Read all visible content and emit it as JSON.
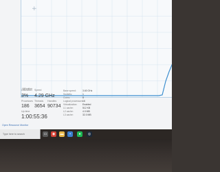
{
  "graph": {
    "title": "Utilization",
    "colors": {
      "grid": "#d4e3ef",
      "line": "#3d8fcf",
      "border": "#b9d2e6",
      "background": "#f7f9fb"
    }
  },
  "stats": {
    "utilization": {
      "label": "Utilization",
      "value": "3%"
    },
    "speed": {
      "label": "Speed",
      "value": "4.29 GHz"
    },
    "processes": {
      "label": "Processes",
      "value": "186"
    },
    "threads": {
      "label": "Threads",
      "value": "3654"
    },
    "handles": {
      "label": "Handles",
      "value": "90734"
    },
    "uptime": {
      "label": "Up time",
      "value": "1:00:55:36"
    }
  },
  "details": [
    {
      "label": "Base speed:",
      "value": "3.60 GHz"
    },
    {
      "label": "Sockets:",
      "value": "1"
    },
    {
      "label": "Cores:",
      "value": "8"
    },
    {
      "label": "Logical processors:",
      "value": "16"
    },
    {
      "label": "Virtualization:",
      "value": "Enabled"
    },
    {
      "label": "L1 cache:",
      "value": "512 KB"
    },
    {
      "label": "L2 cache:",
      "value": "4.0 MB"
    },
    {
      "label": "L3 cache:",
      "value": "32.0 MB"
    }
  ],
  "footer": {
    "resource_monitor_link": "Open Resource Monitor"
  },
  "taskbar": {
    "search_placeholder": "Type here to search",
    "icons": [
      {
        "name": "task-view-icon",
        "glyph": "▭",
        "color": "#5a5a5a"
      },
      {
        "name": "chrome-icon",
        "glyph": "◉",
        "color": "#d64235"
      },
      {
        "name": "folder-icon",
        "glyph": "▬",
        "color": "#e8b84a"
      },
      {
        "name": "store-icon",
        "glyph": "▪",
        "color": "#3b7fd0"
      },
      {
        "name": "spotify-icon",
        "glyph": "●",
        "color": "#1db954"
      },
      {
        "name": "steam-icon",
        "glyph": "◎",
        "color": "#1b2838"
      }
    ]
  }
}
